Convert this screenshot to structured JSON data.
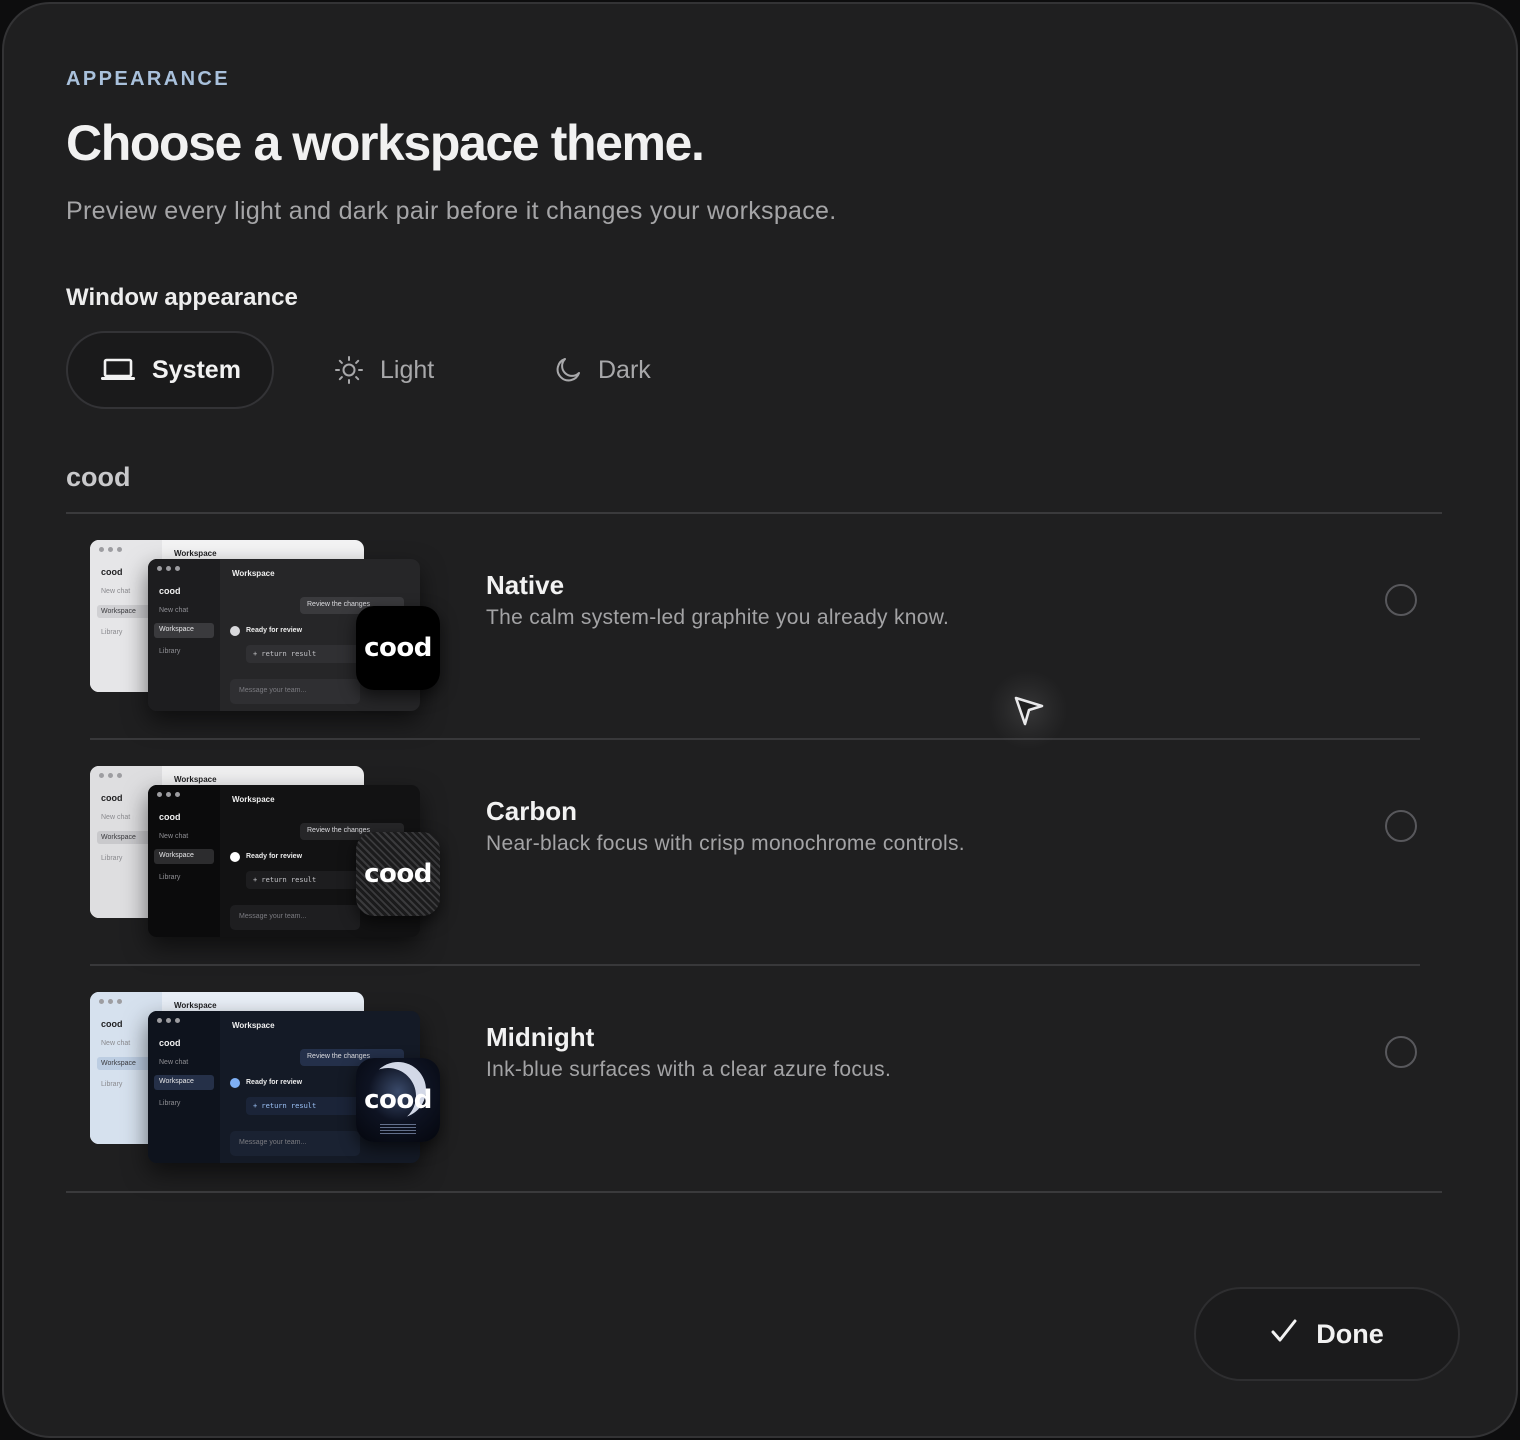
{
  "header": {
    "eyebrow": "APPEARANCE",
    "title": "Choose a workspace theme.",
    "subtitle": "Preview every light and dark pair before it changes your workspace."
  },
  "window_appearance": {
    "label": "Window appearance",
    "options": [
      {
        "label": "System",
        "icon": "laptop-icon",
        "selected": true
      },
      {
        "label": "Light",
        "icon": "sun-icon",
        "selected": false
      },
      {
        "label": "Dark",
        "icon": "moon-icon",
        "selected": false
      }
    ]
  },
  "brand_group": {
    "label": "cood"
  },
  "preview": {
    "window_title": "Workspace",
    "brand": "cood",
    "sidebar_items": [
      "New chat",
      "Workspace",
      "Library"
    ],
    "bubble": "Review the changes",
    "status": "Ready for review",
    "code": "+ return result",
    "message_placeholder": "Message your team...",
    "icon_text": "cood"
  },
  "themes": [
    {
      "name": "Native",
      "description": "The calm system-led graphite you already know.",
      "selected": false,
      "accent": "#000000"
    },
    {
      "name": "Carbon",
      "description": "Near-black focus with crisp monochrome controls.",
      "selected": false,
      "accent": "#1b1b1c"
    },
    {
      "name": "Midnight",
      "description": "Ink-blue surfaces with a clear azure focus.",
      "selected": false,
      "accent": "#7fb0f5"
    }
  ],
  "footer": {
    "done_label": "Done"
  },
  "colors": {
    "background": "#1f1f20",
    "eyebrow": "#a9c1dc",
    "text_primary": "#f2f2f2",
    "text_secondary": "#a5a5a7"
  }
}
